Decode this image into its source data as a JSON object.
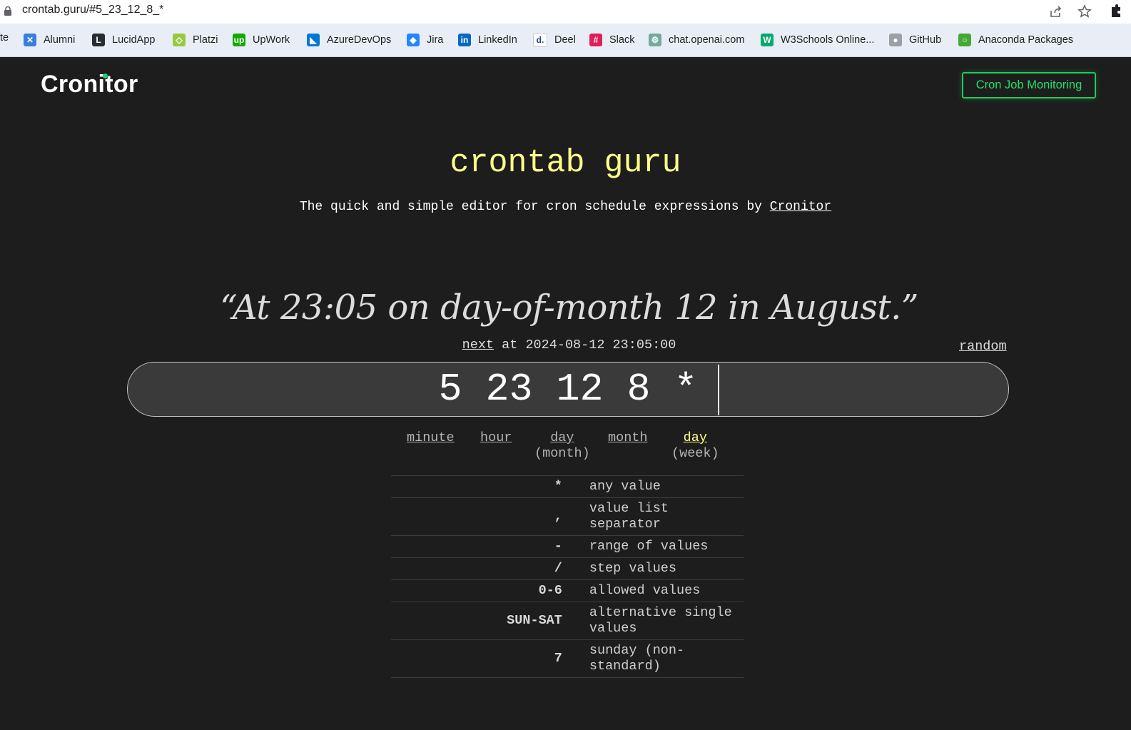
{
  "browser": {
    "url": "crontab.guru/#5_23_12_8_*",
    "bookmarks_cut": "te",
    "bookmarks": [
      {
        "label": "Alumni",
        "icon": "alumni-icon",
        "color": "#3b7ddd",
        "glyph": "✕"
      },
      {
        "label": "LucidApp",
        "icon": "lucidapp-icon",
        "color": "#282c33",
        "glyph": "L"
      },
      {
        "label": "Platzi",
        "icon": "platzi-icon",
        "color": "#98ca3f",
        "glyph": "◇"
      },
      {
        "label": "UpWork",
        "icon": "upwork-icon",
        "color": "#14a800",
        "glyph": "up"
      },
      {
        "label": "AzureDevOps",
        "icon": "azuredevops-icon",
        "color": "#0078d4",
        "glyph": "◣"
      },
      {
        "label": "Jira",
        "icon": "jira-icon",
        "color": "#2684ff",
        "glyph": "◆"
      },
      {
        "label": "LinkedIn",
        "icon": "linkedin-icon",
        "color": "#0a66c2",
        "glyph": "in"
      },
      {
        "label": "Deel",
        "icon": "deel-icon",
        "color": "#ffffff",
        "glyph": "d."
      },
      {
        "label": "Slack",
        "icon": "slack-icon",
        "color": "#e01e5a",
        "glyph": "#"
      },
      {
        "label": "chat.openai.com",
        "icon": "openai-icon",
        "color": "#74aa9c",
        "glyph": "⚙"
      },
      {
        "label": "W3Schools Online...",
        "icon": "w3schools-icon",
        "color": "#04aa6d",
        "glyph": "W"
      },
      {
        "label": "GitHub",
        "icon": "github-icon",
        "color": "#9aa0a6",
        "glyph": "●"
      },
      {
        "label": "Anaconda Packages",
        "icon": "anaconda-icon",
        "color": "#44a833",
        "glyph": "○"
      }
    ]
  },
  "header": {
    "logo": "Cronitor",
    "cta_label": "Cron Job Monitoring",
    "accent": "#1fca5e"
  },
  "hero": {
    "title": "crontab guru",
    "subtitle_prefix": "The quick and simple editor for cron schedule expressions by ",
    "subtitle_link": "Cronitor"
  },
  "schedule": {
    "human_readable": "“At 23:05 on day-of-month 12 in August.”",
    "next_label": "next",
    "next_text": " at 2024-08-12 23:05:00",
    "random_label": "random",
    "expression": "5 23 12 8 *"
  },
  "fields": [
    {
      "name": "minute",
      "sub": ""
    },
    {
      "name": "hour",
      "sub": ""
    },
    {
      "name": "day",
      "sub": "(month)"
    },
    {
      "name": "month",
      "sub": ""
    },
    {
      "name": "day",
      "sub": "(week)",
      "active": true
    }
  ],
  "reference": [
    {
      "symbol": "*",
      "description": "any value"
    },
    {
      "symbol": ",",
      "description": "value list separator"
    },
    {
      "symbol": "-",
      "description": "range of values"
    },
    {
      "symbol": "/",
      "description": "step values"
    },
    {
      "symbol": "0-6",
      "description": "allowed values"
    },
    {
      "symbol": "SUN-SAT",
      "description": "alternative single values"
    },
    {
      "symbol": "7",
      "description": "sunday (non-standard)"
    }
  ]
}
